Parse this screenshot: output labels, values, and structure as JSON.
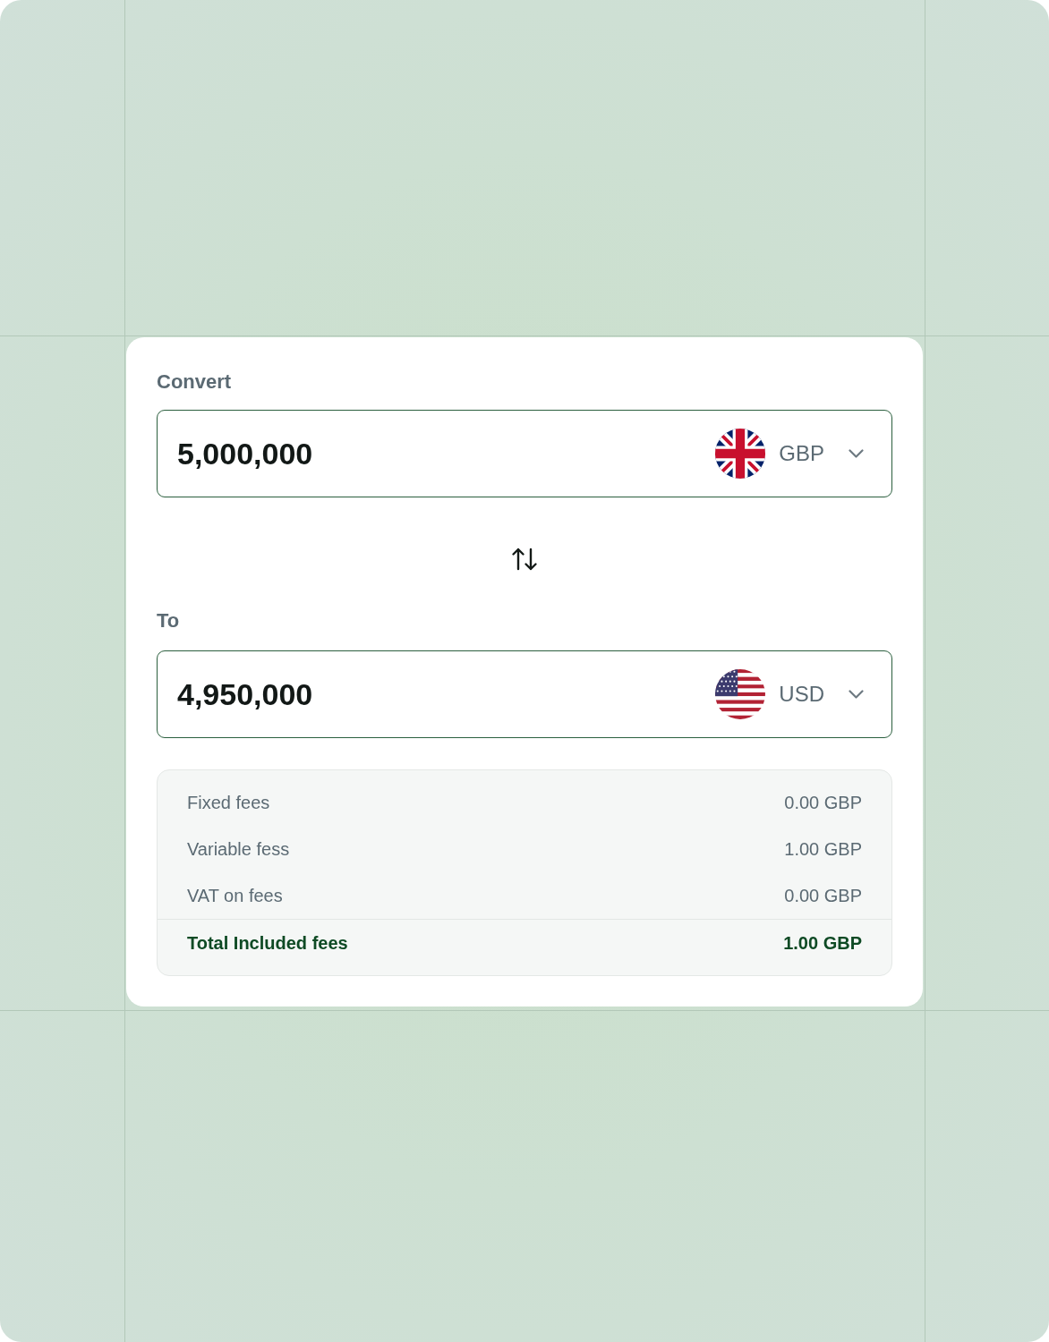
{
  "converter": {
    "from": {
      "label": "Convert",
      "amount": "5,000,000",
      "currency": {
        "kind": "uk",
        "code": "GBP"
      }
    },
    "to": {
      "label": "To",
      "amount": "4,950,000",
      "currency": {
        "kind": "us",
        "code": "USD"
      }
    }
  },
  "fees": {
    "rows": [
      {
        "label": "Fixed fees",
        "value": "0.00 GBP"
      },
      {
        "label": "Variable fess",
        "value": "1.00 GBP"
      },
      {
        "label": "VAT on fees",
        "value": "0.00 GBP"
      }
    ],
    "total": {
      "label": "Total Included fees",
      "value": "1.00 GBP"
    }
  }
}
